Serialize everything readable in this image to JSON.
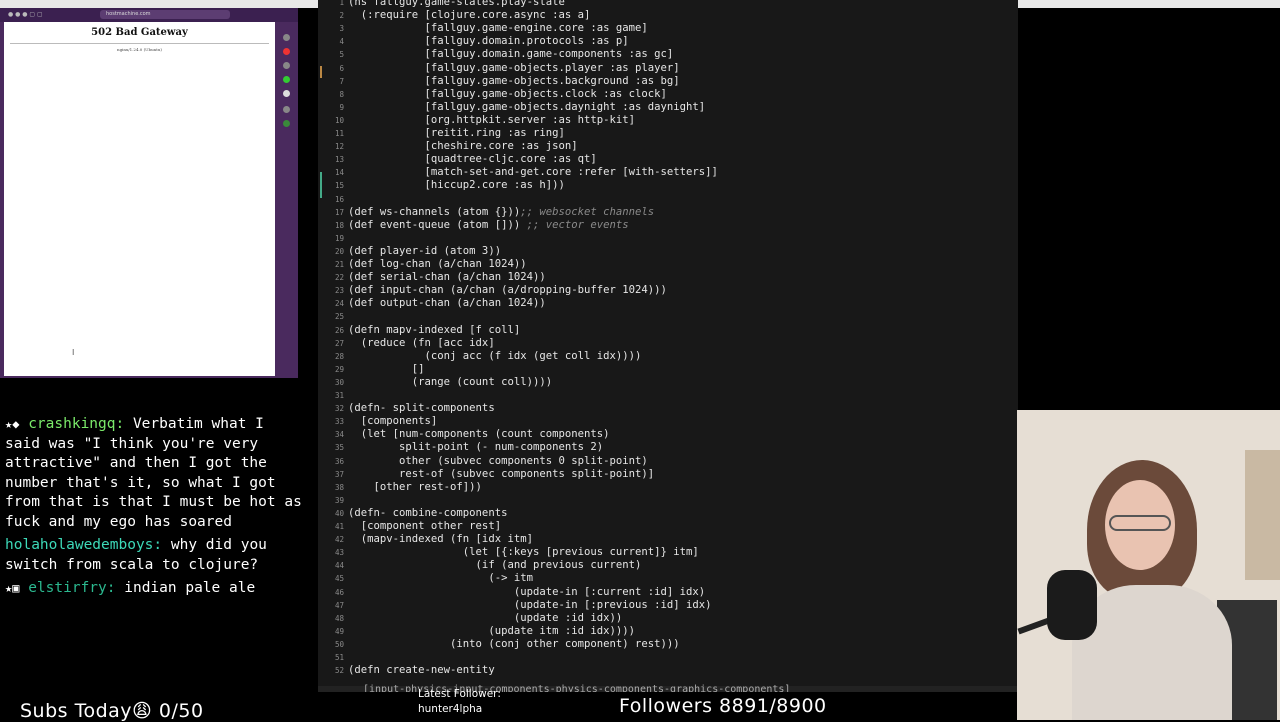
{
  "browser": {
    "url": "hostmachine.com",
    "error_title": "502 Bad Gateway",
    "server_text": "nginx/1.24.0 (Ubuntu)"
  },
  "chat": {
    "messages": [
      {
        "user": "crashkingq:",
        "text": "Verbatim what I said was \"I think you're very attractive\" and then I got the number that's it, so what I got from that is that I must be hot as fuck and my ego has soared"
      },
      {
        "user": "holaholawedemboys:",
        "text": "why did you switch from scala to clojure?"
      },
      {
        "user": "elstirfry:",
        "text": "indian pale ale"
      }
    ]
  },
  "editor": {
    "lines": [
      {
        "n": "1",
        "code": "(ns fallguy.game-states.play-state"
      },
      {
        "n": "2",
        "code": "  (:require [clojure.core.async :as a]"
      },
      {
        "n": "3",
        "code": "            [fallguy.game-engine.core :as game]"
      },
      {
        "n": "4",
        "code": "            [fallguy.domain.protocols :as p]"
      },
      {
        "n": "5",
        "code": "            [fallguy.domain.game-components :as gc]"
      },
      {
        "n": "6",
        "code": "            [fallguy.game-objects.player :as player]"
      },
      {
        "n": "7",
        "code": "            [fallguy.game-objects.background :as bg]"
      },
      {
        "n": "8",
        "code": "            [fallguy.game-objects.clock :as clock]"
      },
      {
        "n": "9",
        "code": "            [fallguy.game-objects.daynight :as daynight]"
      },
      {
        "n": "10",
        "code": "            [org.httpkit.server :as http-kit]"
      },
      {
        "n": "11",
        "code": "            [reitit.ring :as ring]"
      },
      {
        "n": "12",
        "code": "            [cheshire.core :as json]"
      },
      {
        "n": "13",
        "code": "            [quadtree-cljc.core :as qt]"
      },
      {
        "n": "14",
        "code": "            [match-set-and-get.core :refer [with-setters]]"
      },
      {
        "n": "15",
        "code": "            [hiccup2.core :as h]))"
      },
      {
        "n": "16",
        "code": ""
      },
      {
        "n": "17",
        "code": "(def ws-channels (atom {}))",
        "comment": ";; websocket channels"
      },
      {
        "n": "18",
        "code": "(def event-queue (atom []))",
        "comment": " ;; vector events"
      },
      {
        "n": "19",
        "code": ""
      },
      {
        "n": "20",
        "code": "(def player-id (atom 3))"
      },
      {
        "n": "21",
        "code": "(def log-chan (a/chan 1024))"
      },
      {
        "n": "22",
        "code": "(def serial-chan (a/chan 1024))"
      },
      {
        "n": "23",
        "code": "(def input-chan (a/chan (a/dropping-buffer 1024)))"
      },
      {
        "n": "24",
        "code": "(def output-chan (a/chan 1024))"
      },
      {
        "n": "25",
        "code": ""
      },
      {
        "n": "26",
        "code": "(defn mapv-indexed [f coll]"
      },
      {
        "n": "27",
        "code": "  (reduce (fn [acc idx]"
      },
      {
        "n": "28",
        "code": "            (conj acc (f idx (get coll idx))))"
      },
      {
        "n": "29",
        "code": "          []"
      },
      {
        "n": "30",
        "code": "          (range (count coll))))"
      },
      {
        "n": "31",
        "code": ""
      },
      {
        "n": "32",
        "code": "(defn- split-components"
      },
      {
        "n": "33",
        "code": "  [components]"
      },
      {
        "n": "34",
        "code": "  (let [num-components (count components)"
      },
      {
        "n": "35",
        "code": "        split-point (- num-components 2)"
      },
      {
        "n": "36",
        "code": "        other (subvec components 0 split-point)"
      },
      {
        "n": "37",
        "code": "        rest-of (subvec components split-point)]"
      },
      {
        "n": "38",
        "code": "    [other rest-of]))"
      },
      {
        "n": "39",
        "code": ""
      },
      {
        "n": "40",
        "code": "(defn- combine-components"
      },
      {
        "n": "41",
        "code": "  [component other rest]"
      },
      {
        "n": "42",
        "code": "  (mapv-indexed (fn [idx itm]"
      },
      {
        "n": "43",
        "code": "                  (let [{:keys [previous current]} itm]"
      },
      {
        "n": "44",
        "code": "                    (if (and previous current)"
      },
      {
        "n": "45",
        "code": "                      (-> itm"
      },
      {
        "n": "46",
        "code": "                          (update-in [:current :id] idx)"
      },
      {
        "n": "47",
        "code": "                          (update-in [:previous :id] idx)"
      },
      {
        "n": "48",
        "code": "                          (update :id idx))"
      },
      {
        "n": "49",
        "code": "                      (update itm :id idx))))"
      },
      {
        "n": "50",
        "code": "                (into (conj other component) rest)))"
      },
      {
        "n": "51",
        "code": ""
      },
      {
        "n": "52",
        "code": "(defn create-new-entity"
      }
    ],
    "partial_line": "[input-physics-input-components-physics-components-graphics-components]"
  },
  "overlay": {
    "subs": "Subs Today😩 0/50",
    "latest_label": "Latest Follower:",
    "latest_name": "hunter4lpha",
    "followers": "Followers 8891/8900"
  }
}
